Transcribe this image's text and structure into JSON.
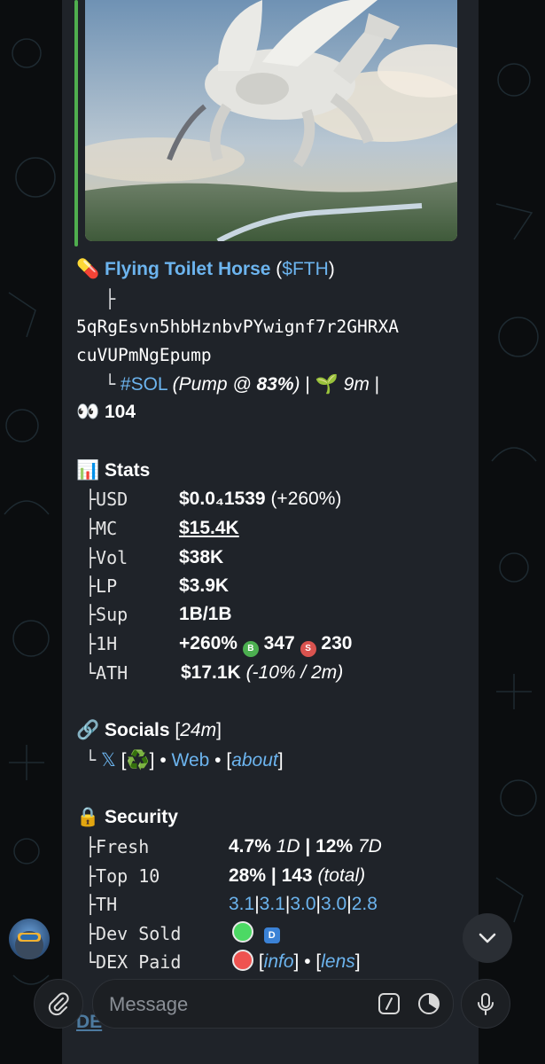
{
  "header": {
    "pill_emoji": "💊",
    "token_name": "Flying Toilet Horse",
    "ticker_open": " (",
    "ticker": "$FTH",
    "ticker_close": ")"
  },
  "address": {
    "tree": "├",
    "line1": "5qRgEsvn5hbHznbvPYwignf7r2GHRXA",
    "line2": "cuVUPmNgEpump"
  },
  "chain": {
    "tree": "└",
    "tag": "#SOL",
    "pump_prefix": "(Pump @ ",
    "pump_pct": "83%",
    "pump_suffix": ")",
    "sep1": " | ",
    "seed_emoji": "🌱",
    "age": "9m",
    "sep2": " |",
    "eyes_emoji": "👀",
    "holders": "104"
  },
  "stats": {
    "emoji": "📊",
    "title": "Stats",
    "rows": [
      {
        "tree": "├",
        "key": "USD",
        "value": "$0.0₄1539",
        "extra": " (+260%)"
      },
      {
        "tree": "├",
        "key": "MC",
        "value": "$15.4K"
      },
      {
        "tree": "├",
        "key": "Vol",
        "value": "$38K"
      },
      {
        "tree": "├",
        "key": "LP",
        "value": "$3.9K"
      },
      {
        "tree": "├",
        "key": "Sup",
        "value": "1B/1B"
      },
      {
        "tree": "├",
        "key": "1H",
        "value": "+260%",
        "buys_badge": "B",
        "buys": "347",
        "sells_badge": "S",
        "sells": "230"
      },
      {
        "tree": "└",
        "key": "ATH",
        "value": "$17.1K",
        "extra": "(-10% / 2m)"
      }
    ]
  },
  "socials": {
    "emoji": "🔗",
    "title": "Socials",
    "age_open": " [",
    "age": "24m",
    "age_close": "]",
    "tree": "└",
    "x": "𝕏",
    "x_extra_open": " [",
    "x_extra": "♻️",
    "x_extra_close": "]",
    "dot1": " • ",
    "web": "Web",
    "dot2": " • ",
    "about_open": "[",
    "about": "about",
    "about_close": "]"
  },
  "security": {
    "emoji": "🔒",
    "title": "Security",
    "fresh": {
      "tree": "├",
      "key": "Fresh",
      "v1": "4.7%",
      "l1": " 1D",
      "sep": " | ",
      "v2": "12%",
      "l2": " 7D"
    },
    "top10": {
      "tree": "├",
      "key": "Top 10",
      "v1": "28%",
      "sep": " | ",
      "v2": "143",
      "l2": " (total)"
    },
    "th": {
      "tree": "├",
      "key": "TH",
      "values": [
        "3.1",
        "3.1",
        "3.0",
        "3.0",
        "2.8"
      ]
    },
    "dev_sold": {
      "tree": "├",
      "key": "Dev Sold",
      "badge": "D"
    },
    "dex_paid": {
      "tree": "└",
      "key": "DEX Paid",
      "info_open": " [",
      "info": "info",
      "info_close": "]",
      "dot": " • ",
      "lens_open": "[",
      "lens": "lens",
      "lens_close": "]"
    }
  },
  "cut_text": "DE",
  "composer": {
    "placeholder": "Message"
  },
  "colors": {
    "link": "#6cb4ee",
    "bubble": "#1f2329",
    "accent_bar": "#4fae4e",
    "green": "#4cd964",
    "red": "#ef5350"
  },
  "icons": {
    "attach": "paperclip-icon",
    "commands": "slash-command-icon",
    "timer": "clock-icon",
    "mic": "microphone-icon",
    "scroll": "chevron-down-icon"
  }
}
